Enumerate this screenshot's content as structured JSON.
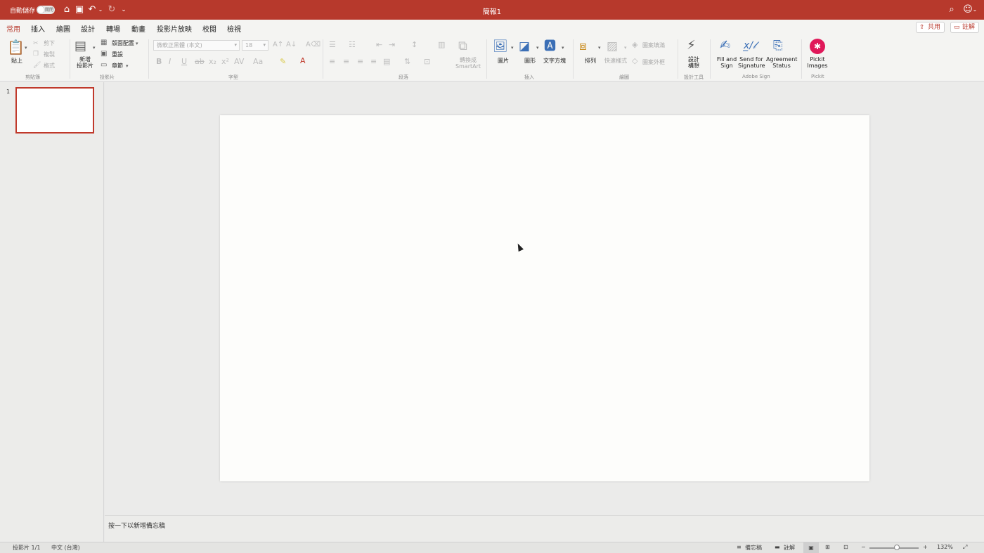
{
  "titlebar": {
    "autosave_label": "自動儲存",
    "autosave_state": "關閉",
    "doc_title": "簡報1"
  },
  "tabs": [
    "常用",
    "插入",
    "繪圖",
    "設計",
    "轉場",
    "動畫",
    "投影片放映",
    "校閱",
    "檢視"
  ],
  "active_tab": "常用",
  "share_label": "共用",
  "comment_label": "註解",
  "ribbon": {
    "clipboard": {
      "paste": "貼上",
      "cut": "剪下",
      "copy": "複製",
      "format": "格式",
      "group": "剪貼簿"
    },
    "slides": {
      "new_slide_1": "新增",
      "new_slide_2": "投影片",
      "layout": "版面配置",
      "reset": "重設",
      "section": "章節",
      "group": "投影片"
    },
    "font": {
      "font_name": "微軟正黑體 (本文)",
      "font_size": "18",
      "group": "字型"
    },
    "paragraph": {
      "convert_1": "轉換成",
      "convert_2": "SmartArt",
      "group": "段落"
    },
    "insert": {
      "picture": "圖片",
      "shape": "圖形",
      "textbox": "文字方塊",
      "group": "插入"
    },
    "drawing": {
      "arrange": "排列",
      "quick_styles": "快速樣式",
      "shape_fill": "圖案填滿",
      "shape_outline": "圖案外框",
      "group": "繪圖"
    },
    "designer": {
      "label_1": "設計",
      "label_2": "構想",
      "group": "設計工具"
    },
    "adobe": {
      "fill_sign_1": "Fill and",
      "fill_sign_2": "Sign",
      "send_sig_1": "Send for",
      "send_sig_2": "Signature",
      "agreement_1": "Agreement",
      "agreement_2": "Status",
      "group": "Adobe Sign"
    },
    "pickit": {
      "label_1": "Pickit",
      "label_2": "Images",
      "group": "Pickit"
    }
  },
  "slide_panel": {
    "slide_number": "1"
  },
  "notes": {
    "placeholder": "按一下以新增備忘稿"
  },
  "status": {
    "slide_count": "投影片 1/1",
    "language": "中文 (台灣)",
    "notes_btn": "備忘稿",
    "comments_btn": "註解",
    "zoom": "132%"
  },
  "colors": {
    "accent": "#b7392c",
    "pickit": "#e0195a",
    "adobe_blue": "#3b6fb6"
  }
}
